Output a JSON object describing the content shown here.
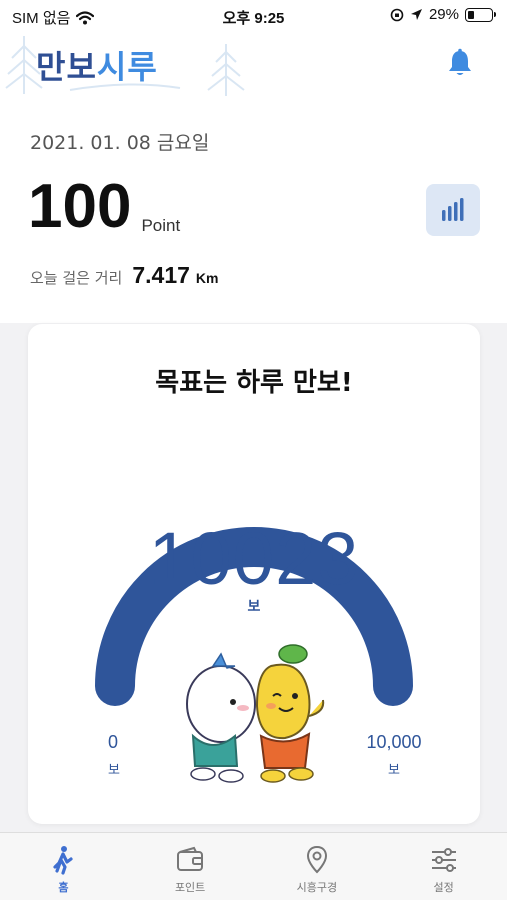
{
  "status_bar": {
    "carrier": "SIM 없음",
    "time": "오후 9:25",
    "battery": "29%",
    "battery_level": 0.29
  },
  "header": {
    "logo_part1": "만보",
    "logo_part2": "시루",
    "bell_icon": "bell-icon"
  },
  "summary": {
    "date": "2021. 01. 08 금요일",
    "points": "100",
    "points_unit": "Point",
    "stats_icon": "bar-chart-icon",
    "distance_label": "오늘 걸은 거리",
    "distance_value": "7.417",
    "distance_unit": "Km"
  },
  "goal_card": {
    "title": "목표는 하루 만보!",
    "steps": "10023",
    "steps_unit": "보",
    "min_value": "0",
    "min_unit": "보",
    "max_value": "10,000",
    "max_unit": "보",
    "progress": 1.0
  },
  "colors": {
    "gauge": "#2f559a",
    "accent": "#3f8be0",
    "active_tab": "#3f6fd0"
  },
  "tabs": [
    {
      "label": "홈",
      "icon": "walking-icon",
      "active": true
    },
    {
      "label": "포인트",
      "icon": "wallet-icon",
      "active": false
    },
    {
      "label": "시흥구경",
      "icon": "location-pin-icon",
      "active": false
    },
    {
      "label": "설정",
      "icon": "sliders-icon",
      "active": false
    }
  ]
}
